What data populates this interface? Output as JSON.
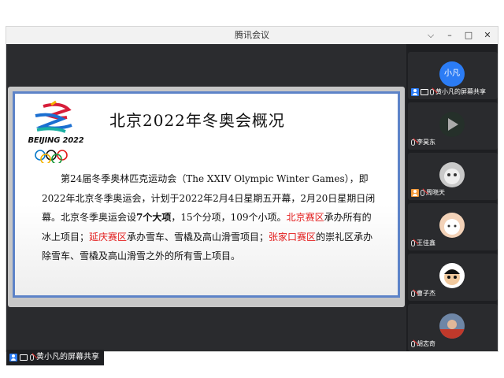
{
  "window": {
    "title": "腾讯会议"
  },
  "window_controls": {
    "menu": "⌵",
    "minimize": "–",
    "maximize": "□",
    "close": "✕"
  },
  "slide": {
    "logo_text": "BEIJING 2022",
    "title": "北京2022年冬奥会概况",
    "body": {
      "p1": "第24届冬季奥林匹克运动会（The XXIV Olympic Winter Games），即2022年北京冬季奥运会，计划于2022年2月4日星期五开幕，2月20日星期日闭幕。北京冬季奥运会设",
      "bold_1": "7个大项",
      "p2": "，15个分项，109个小项。",
      "red_1": "北京赛区",
      "p3": "承办所有的冰上项目；",
      "red_2": "延庆赛区",
      "p4": "承办雪车、雪橇及高山滑雪项目；",
      "red_3": "张家口赛区",
      "p5": "的崇礼区承办除雪车、雪橇及高山滑雪之外的所有雪上项目。"
    }
  },
  "presenter_label": "黄小凡的屏幕共享",
  "participants": [
    {
      "name": "黄小凡的屏幕共享",
      "avatar_text": "小凡",
      "avatar_color": "#2b7cf5"
    },
    {
      "name": "李昊东",
      "avatar_text": "",
      "avatar_color": "#25302a"
    },
    {
      "name": "周晓天",
      "avatar_text": "",
      "avatar_color": "#c9c9c9"
    },
    {
      "name": "王佳鑫",
      "avatar_text": "",
      "avatar_color": "#f3d2b8"
    },
    {
      "name": "曹子杰",
      "avatar_text": "",
      "avatar_color": "#ffffff"
    },
    {
      "name": "胡志奇",
      "avatar_text": "",
      "avatar_color": "#6e86a6"
    }
  ]
}
